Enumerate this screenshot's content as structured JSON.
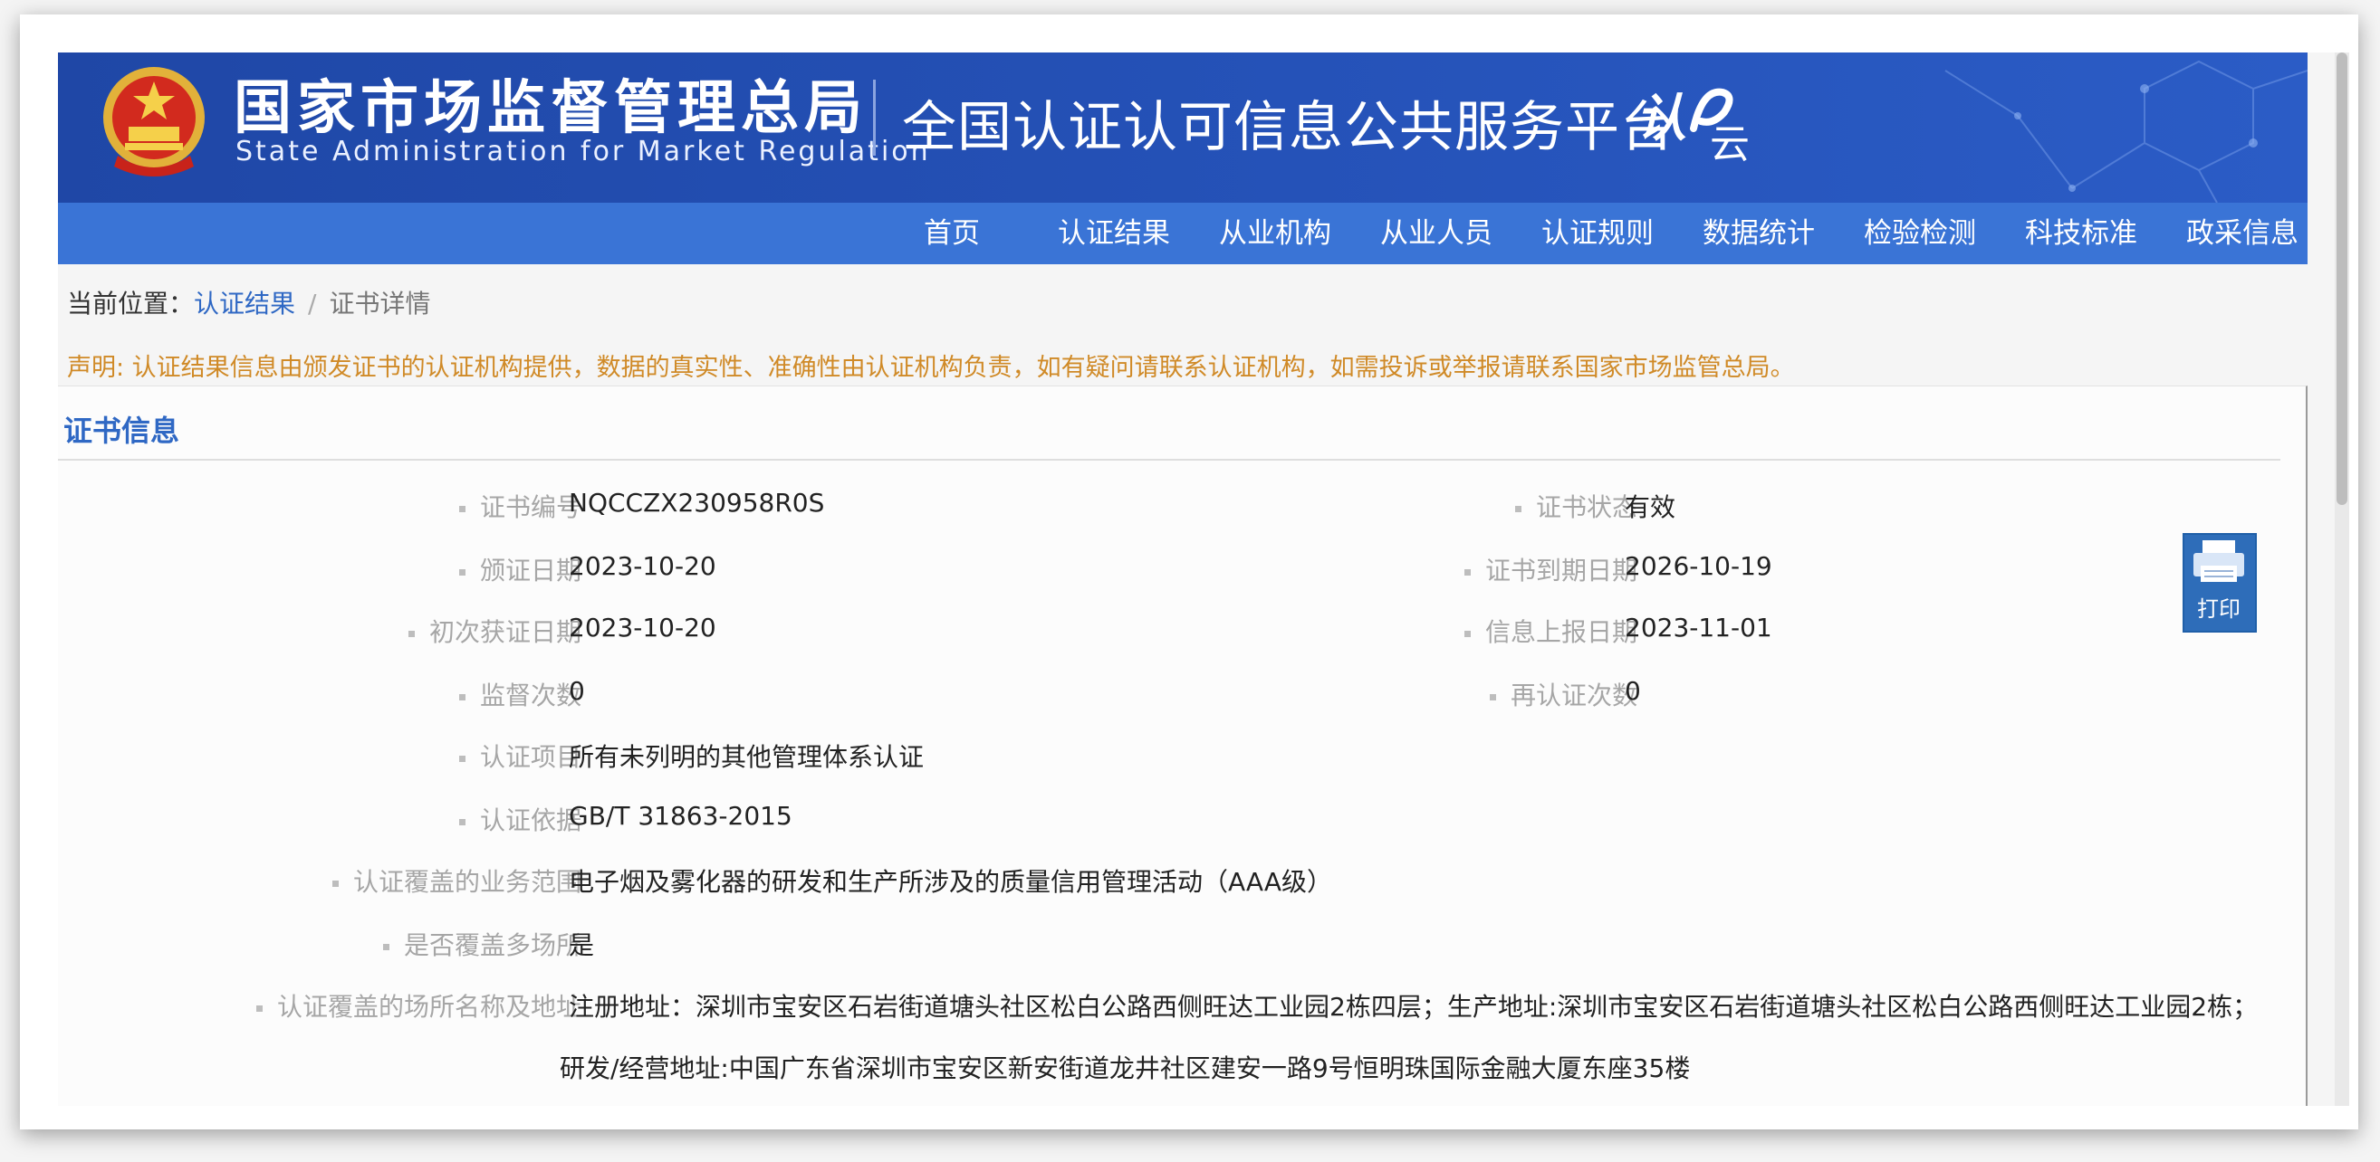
{
  "header": {
    "agency_cn": "国家市场监督管理总局",
    "agency_en": "State Administration  for  Market Regulation",
    "platform": "全国认证认可信息公共服务平台",
    "logo_text": "认云"
  },
  "nav": {
    "items": [
      "首页",
      "认证结果",
      "从业机构",
      "从业人员",
      "认证规则",
      "数据统计",
      "检验检测",
      "科技标准",
      "政采信息"
    ]
  },
  "breadcrumb": {
    "prefix": "当前位置：",
    "link": "认证结果",
    "separator": "/",
    "current": "证书详情"
  },
  "notice": "声明: 认证结果信息由颁发证书的认证机构提供，数据的真实性、准确性由认证机构负责，如有疑问请联系认证机构，如需投诉或举报请联系国家市场监管总局。",
  "section_title": "证书信息",
  "fields": {
    "cert_no": {
      "label": "证书编号",
      "value": "NQCCZX230958R0S"
    },
    "cert_status": {
      "label": "证书状态",
      "value": "有效"
    },
    "issue_date": {
      "label": "颁证日期",
      "value": "2023-10-20"
    },
    "expire_date": {
      "label": "证书到期日期",
      "value": "2026-10-19"
    },
    "first_date": {
      "label": "初次获证日期",
      "value": "2023-10-20"
    },
    "report_date": {
      "label": "信息上报日期",
      "value": "2023-11-01"
    },
    "supervision_count": {
      "label": "监督次数",
      "value": "0"
    },
    "recert_count": {
      "label": "再认证次数",
      "value": "0"
    },
    "project": {
      "label": "认证项目",
      "value": "所有未列明的其他管理体系认证"
    },
    "basis": {
      "label": "认证依据",
      "value": "GB/T 31863-2015"
    },
    "scope": {
      "label": "认证覆盖的业务范围",
      "value": "电子烟及雾化器的研发和生产所涉及的质量信用管理活动（AAA级）"
    },
    "multi_site": {
      "label": "是否覆盖多场所",
      "value": "是"
    },
    "sites": {
      "label": "认证覆盖的场所名称及地址",
      "line1": "注册地址：深圳市宝安区石岩街道塘头社区松白公路西侧旺达工业园2栋四层；生产地址:深圳市宝安区石岩街道塘头社区松白公路西侧旺达工业园2栋；",
      "line2": "研发/经营地址:中国广东省深圳市宝安区新安街道龙井社区建安一路9号恒明珠国际金融大厦东座35楼"
    }
  },
  "print_button": "打印",
  "colors": {
    "banner": "#2552b8",
    "nav": "#3a74d6",
    "link": "#2f68c4",
    "notice": "#d08a27"
  }
}
